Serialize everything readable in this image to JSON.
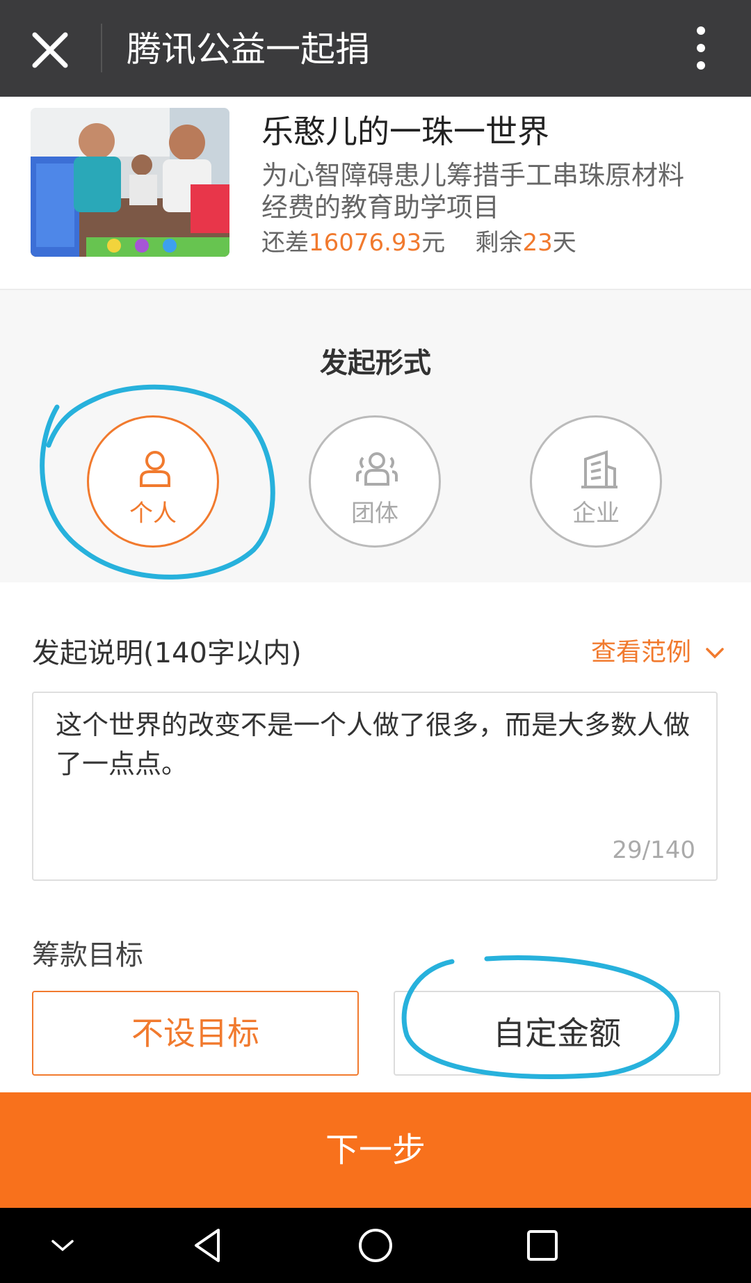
{
  "header": {
    "title": "腾讯公益一起捐",
    "close_icon": "close-icon",
    "more_icon": "more-vertical-icon"
  },
  "project": {
    "title": "乐憨儿的一珠一世界",
    "description": "为心智障碍患儿筹措手工串珠原材料经费的教育助学项目",
    "remaining_prefix": "还差",
    "remaining_amount": "16076.93",
    "remaining_unit": "元",
    "days_prefix": "剩余",
    "days_value": "23",
    "days_unit": "天"
  },
  "launch_form": {
    "title": "发起形式",
    "options": [
      {
        "label": "个人",
        "icon": "person-icon",
        "selected": true
      },
      {
        "label": "团体",
        "icon": "group-icon",
        "selected": false
      },
      {
        "label": "企业",
        "icon": "building-icon",
        "selected": false
      }
    ]
  },
  "description_field": {
    "label": "发起说明(140字以内)",
    "example_link": "查看范例",
    "value": "这个世界的改变不是一个人做了很多，而是大多数人做了一点点。",
    "counter": "29/140"
  },
  "goal": {
    "label": "筹款目标",
    "no_goal": "不设目标",
    "custom": "自定金额"
  },
  "next_button": "下一步",
  "colors": {
    "accent": "#f17a2e",
    "next_bg": "#f8711c",
    "header_bg": "#3b3b3d",
    "annotation": "#27b1dc"
  }
}
